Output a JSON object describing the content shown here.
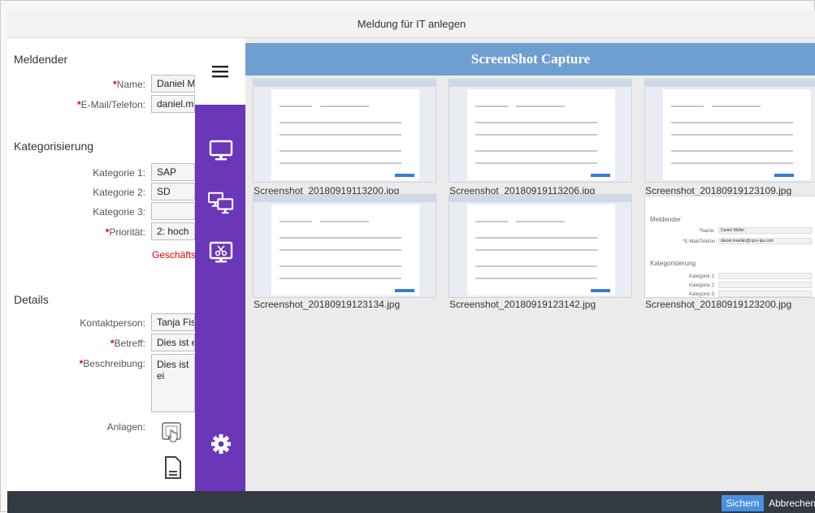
{
  "window": {
    "title": "Meldung für IT anlegen"
  },
  "form": {
    "reporter_section": "Meldender",
    "name_label": "Name:",
    "name_value": "Daniel Mü",
    "contact_label": "E-Mail/Telefon:",
    "contact_value": "daniel.mu",
    "category_section": "Kategorisierung",
    "cat1_label": "Kategorie 1:",
    "cat1_value": "SAP",
    "cat2_label": "Kategorie 2:",
    "cat2_value": "SD",
    "cat3_label": "Kategorie 3:",
    "cat3_value": "",
    "priority_label": "Priorität:",
    "priority_value": "2: hoch",
    "red_link": "Geschäftsa",
    "details_section": "Details",
    "contact_person_label": "Kontaktperson:",
    "contact_person_value": "Tanja Fisc",
    "subject_label": "Betreff:",
    "subject_value": "Dies ist ei",
    "description_label": "Beschreibung:",
    "description_value": "Dies ist ei",
    "attachments_label": "Anlagen:",
    "required_mark": "*"
  },
  "rail": {
    "icons": [
      "hamburger-menu-icon",
      "monitor-icon",
      "dual-monitor-icon",
      "screen-capture-scissors-icon",
      "settings-gear-icon"
    ]
  },
  "panel": {
    "title": "ScreenShot Capture",
    "thumbnails": [
      {
        "caption": "Screenshot_20180919113200.jpg"
      },
      {
        "caption": "Screenshot_20180919113206.jpg"
      },
      {
        "caption": "Screenshot_20180919123109.jpg"
      },
      {
        "caption": "Screenshot_20180919123134.jpg"
      },
      {
        "caption": "Screenshot_20180919123142.jpg"
      },
      {
        "caption": "Screenshot_20180919123200.jpg"
      }
    ],
    "preview": {
      "section": "Meldender",
      "name_label": "*Name:",
      "name_value": "Daniel Müller",
      "contact_label": "*E-Mail/Telefon:",
      "contact_value": "daniel.mueller@cpro-ips.com",
      "category_section": "Kategorisierung",
      "cat1_label": "Kategorie 1:",
      "cat2_label": "Kategorie 2:",
      "cat3_label": "Kategorie 3:"
    }
  },
  "footer": {
    "save_label": "Sichern",
    "cancel_label": "Abbrechen"
  },
  "colors": {
    "rail": "#6a37b8",
    "panel_header": "#6f9fd1",
    "primary_button": "#4a90e2",
    "footer": "#343a42",
    "required": "#d00000"
  }
}
